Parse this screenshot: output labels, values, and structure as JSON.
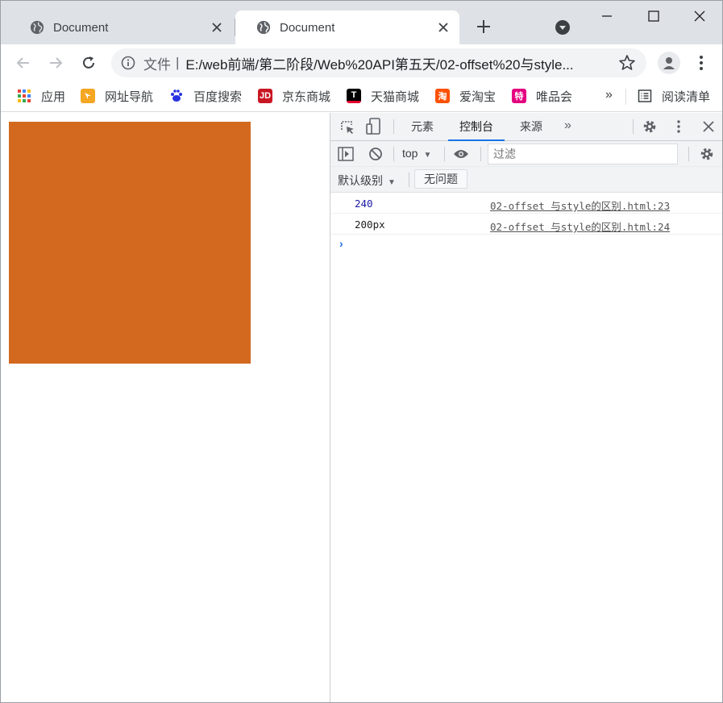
{
  "tabs": [
    {
      "title": "Document",
      "active": false
    },
    {
      "title": "Document",
      "active": true
    }
  ],
  "address_bar": {
    "scheme_label": "文件",
    "separator": "|",
    "url": "E:/web前端/第二阶段/Web%20API第五天/02-offset%20与style..."
  },
  "bookmarks": [
    {
      "label": "应用",
      "icon": "apps-grid-icon"
    },
    {
      "label": "网址导航",
      "icon": "nav-arrow-icon",
      "color": "#f5a623"
    },
    {
      "label": "百度搜索",
      "icon": "baidu-paw-icon",
      "color": "#2932e1"
    },
    {
      "label": "京东商城",
      "icon": "jd-icon",
      "glyph": "JD",
      "color": "#c91623"
    },
    {
      "label": "天猫商城",
      "icon": "tmall-icon",
      "glyph": "T",
      "color": "#000000"
    },
    {
      "label": "爱淘宝",
      "icon": "taobao-icon",
      "glyph": "淘",
      "color": "#ff5000"
    },
    {
      "label": "唯品会",
      "icon": "vip-icon",
      "glyph": "特",
      "color": "#e4007f"
    }
  ],
  "bookmarks_overflow": "»",
  "reading_list": {
    "label": "阅读清单",
    "icon": "reading-list-icon"
  },
  "page": {
    "box_color": "#d2691e"
  },
  "devtools": {
    "tabs": [
      "元素",
      "控制台",
      "来源"
    ],
    "active_tab": "控制台",
    "more_tabs": "»",
    "context": "top",
    "filter_placeholder": "过滤",
    "log_level": "默认级别",
    "issues_button": "无问题",
    "console_messages": [
      {
        "value": "240",
        "type": "number",
        "source": "02-offset 与style的区别.html:23"
      },
      {
        "value": "200px",
        "type": "string",
        "source": "02-offset 与style的区别.html:24"
      }
    ]
  }
}
